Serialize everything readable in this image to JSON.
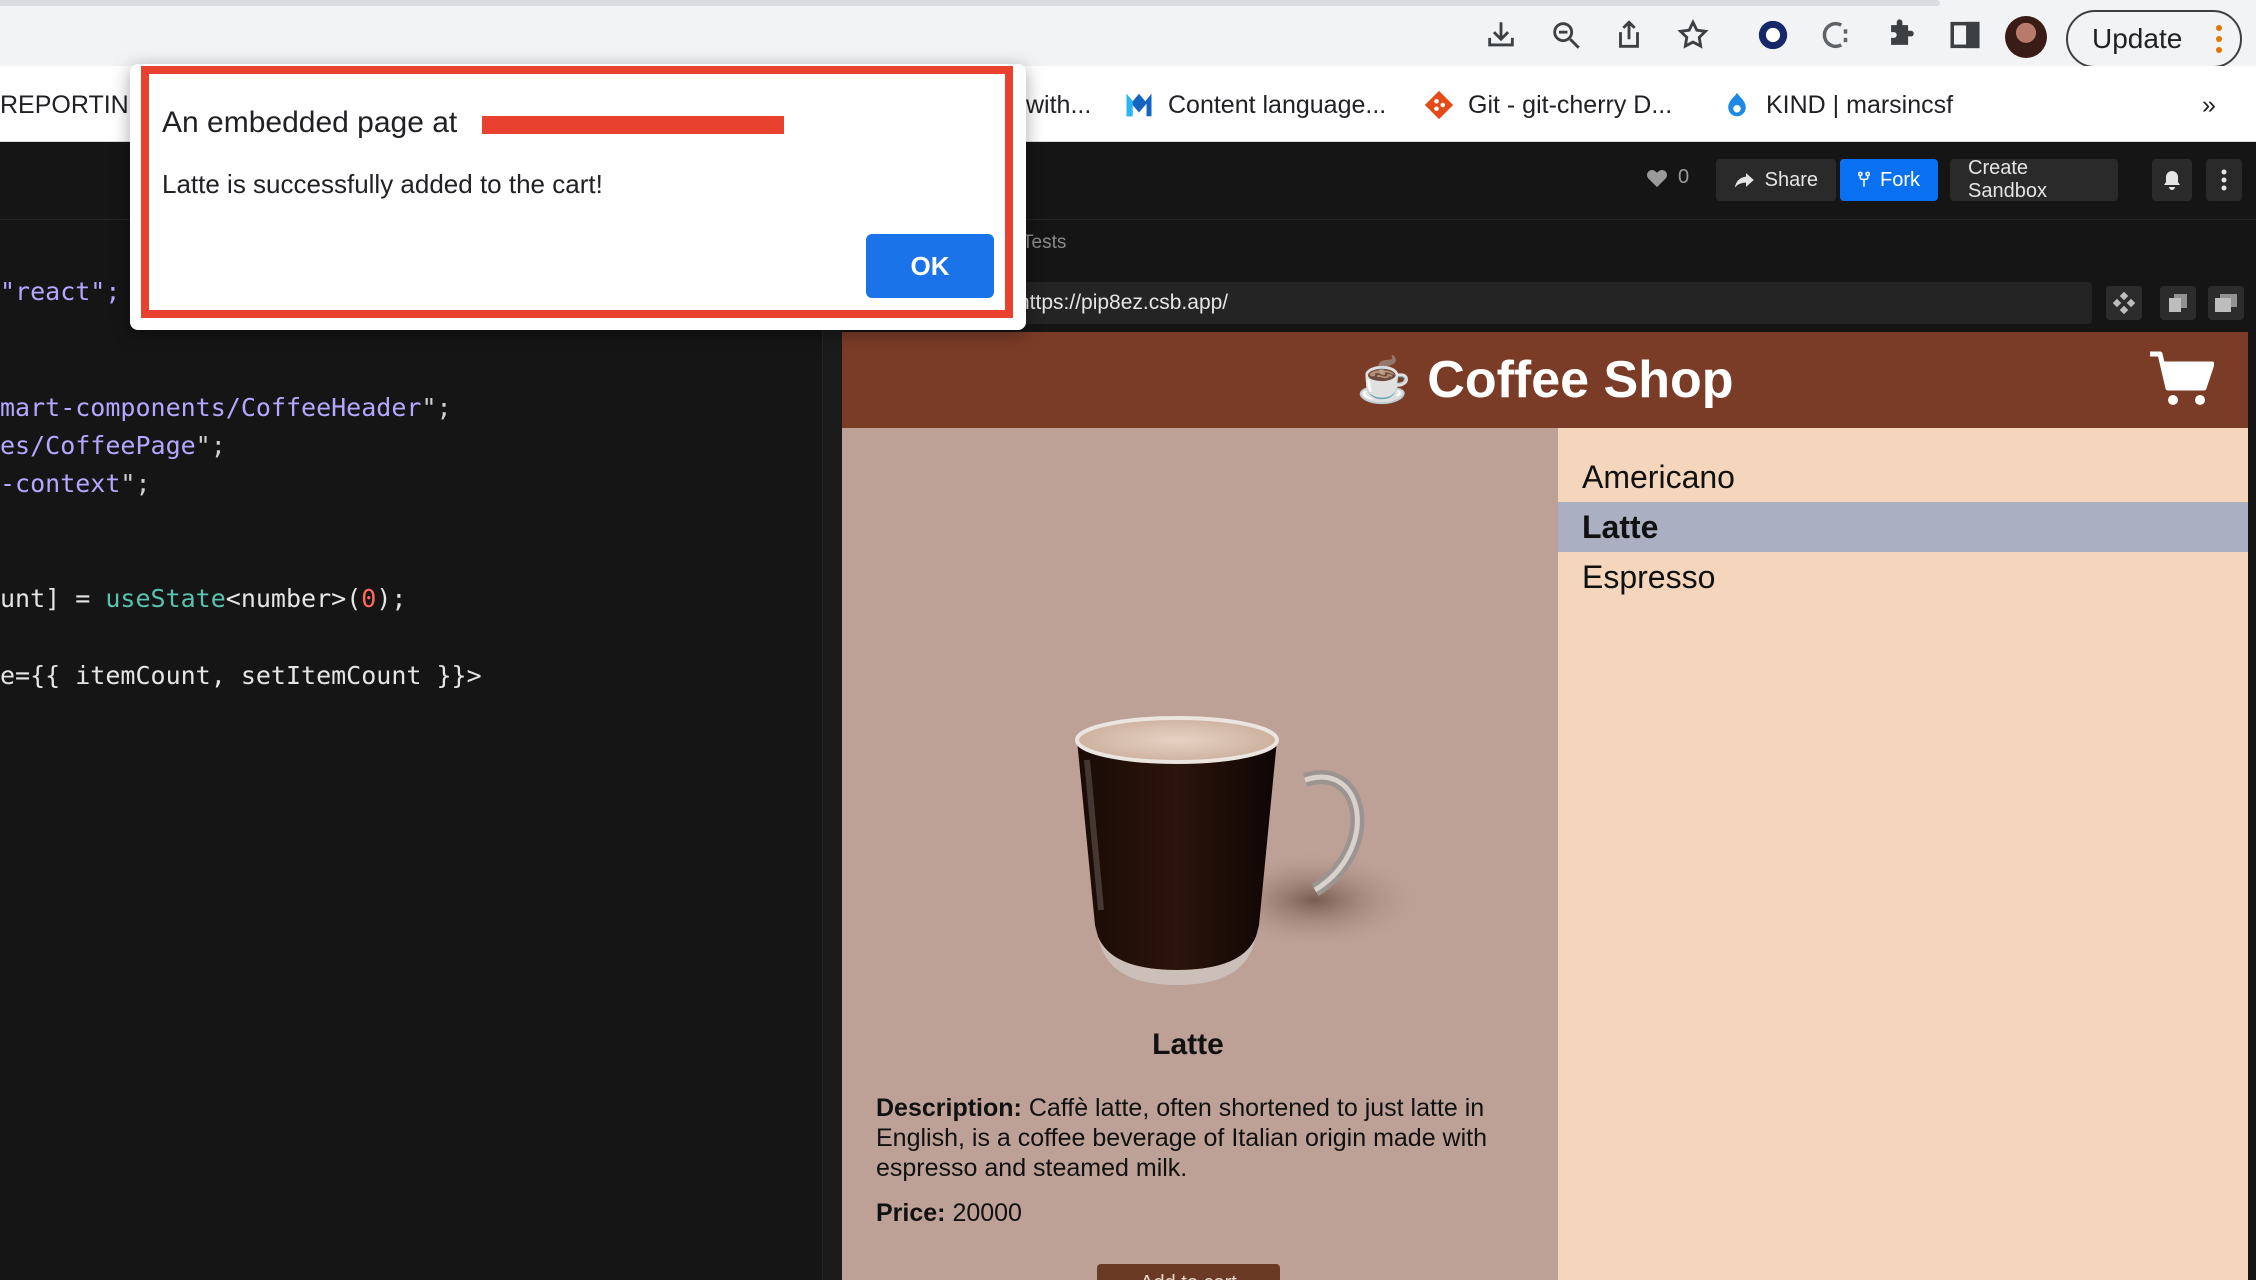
{
  "browser": {
    "update_label": "Update",
    "icons": [
      "download-icon",
      "zoom-out-icon",
      "share-icon",
      "star-icon",
      "extension-circle-icon",
      "extension-c-icon",
      "puzzle-icon",
      "side-panel-icon"
    ]
  },
  "bookmarks": [
    {
      "label": "REPORTING",
      "icon": "none"
    },
    {
      "label": "with...",
      "icon": "none"
    },
    {
      "label": "Content language...",
      "icon": "m-logo-icon"
    },
    {
      "label": "Git - git-cherry D...",
      "icon": "git-icon"
    },
    {
      "label": "KIND | marsincsf",
      "icon": "drupal-icon"
    },
    {
      "label": "»",
      "icon": "none"
    }
  ],
  "csb_header": {
    "likes": "0",
    "share_label": "Share",
    "fork_label": "Fork",
    "create_label": "Create Sandbox"
  },
  "editor": {
    "lines": {
      "l1": "\"react\";",
      "l2a": "mart-components/CoffeeHeader",
      "l3a": "es/CoffeePage",
      "l4a": "-context",
      "l5a": "unt] = ",
      "l5b": "useState",
      "l5c": "<number>(",
      "l5d": "0",
      "l5e": ");",
      "l6a": "e={{ itemCount, setItemCount }}>"
    }
  },
  "preview": {
    "tests_tab": "Tests",
    "url": "https://pip8ez.csb.app/"
  },
  "app": {
    "title": "Coffee Shop",
    "title_icon": "☕",
    "menu": [
      {
        "label": "Americano",
        "selected": false
      },
      {
        "label": "Latte",
        "selected": true
      },
      {
        "label": "Espresso",
        "selected": false
      }
    ],
    "detail": {
      "name": "Latte",
      "description_label": "Description:",
      "description": "Caffè latte, often shortened to just latte in English, is a coffee beverage of Italian origin made with espresso and steamed milk.",
      "price_label": "Price:",
      "price": "20000",
      "add_button": "Add to cart"
    }
  },
  "alert": {
    "heading": "An embedded page at",
    "message": "Latte is successfully added to the cart!",
    "ok_label": "OK",
    "highlight_color": "#e8412f"
  }
}
